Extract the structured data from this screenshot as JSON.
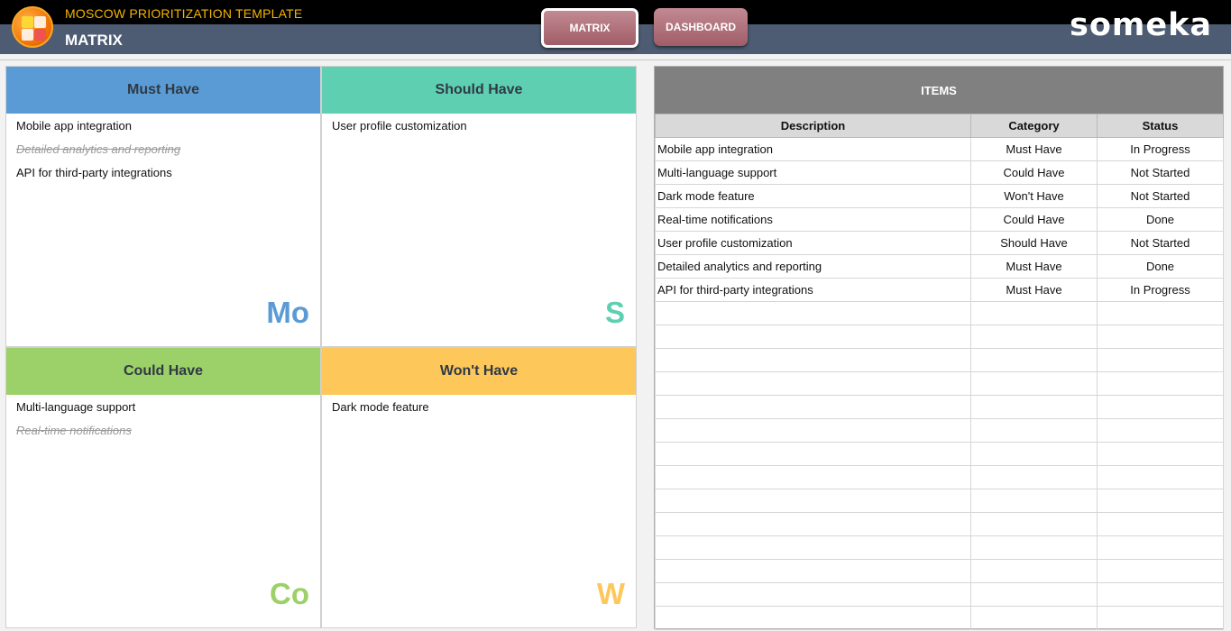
{
  "header": {
    "app_title": "MOSCOW PRIORITIZATION TEMPLATE",
    "page_title": "MATRIX",
    "nav": {
      "matrix": "MATRIX",
      "dashboard": "DASHBOARD"
    },
    "brand": "someka"
  },
  "colors": {
    "must": "#5b9bd5",
    "should": "#5fcfb2",
    "could": "#9cd068",
    "wont": "#fdc75a",
    "header_bg": "#4d5c72",
    "app_title": "#f5b400",
    "nav_button": "#b27880"
  },
  "quadrants": {
    "must": {
      "title": "Must Have",
      "letter": "Mo",
      "items": [
        {
          "text": "Mobile app integration",
          "done": false
        },
        {
          "text": "Detailed analytics and reporting",
          "done": true
        },
        {
          "text": "API for third-party integrations",
          "done": false
        }
      ]
    },
    "should": {
      "title": "Should Have",
      "letter": "S",
      "items": [
        {
          "text": "User profile customization",
          "done": false
        }
      ]
    },
    "could": {
      "title": "Could Have",
      "letter": "Co",
      "items": [
        {
          "text": "Multi-language support",
          "done": false
        },
        {
          "text": "Real-time notifications",
          "done": true
        }
      ]
    },
    "wont": {
      "title": "Won't Have",
      "letter": "W",
      "items": [
        {
          "text": "Dark mode feature",
          "done": false
        }
      ]
    }
  },
  "items_table": {
    "title": "ITEMS",
    "columns": [
      "Description",
      "Category",
      "Status"
    ],
    "rows": [
      [
        "Mobile app integration",
        "Must Have",
        "In Progress"
      ],
      [
        "Multi-language support",
        "Could Have",
        "Not Started"
      ],
      [
        "Dark mode feature",
        "Won't Have",
        "Not Started"
      ],
      [
        "Real-time notifications",
        "Could Have",
        "Done"
      ],
      [
        "User profile customization",
        "Should Have",
        "Not Started"
      ],
      [
        "Detailed analytics and reporting",
        "Must Have",
        "Done"
      ],
      [
        "API for third-party integrations",
        "Must Have",
        "In Progress"
      ]
    ],
    "blank_rows": 14
  }
}
